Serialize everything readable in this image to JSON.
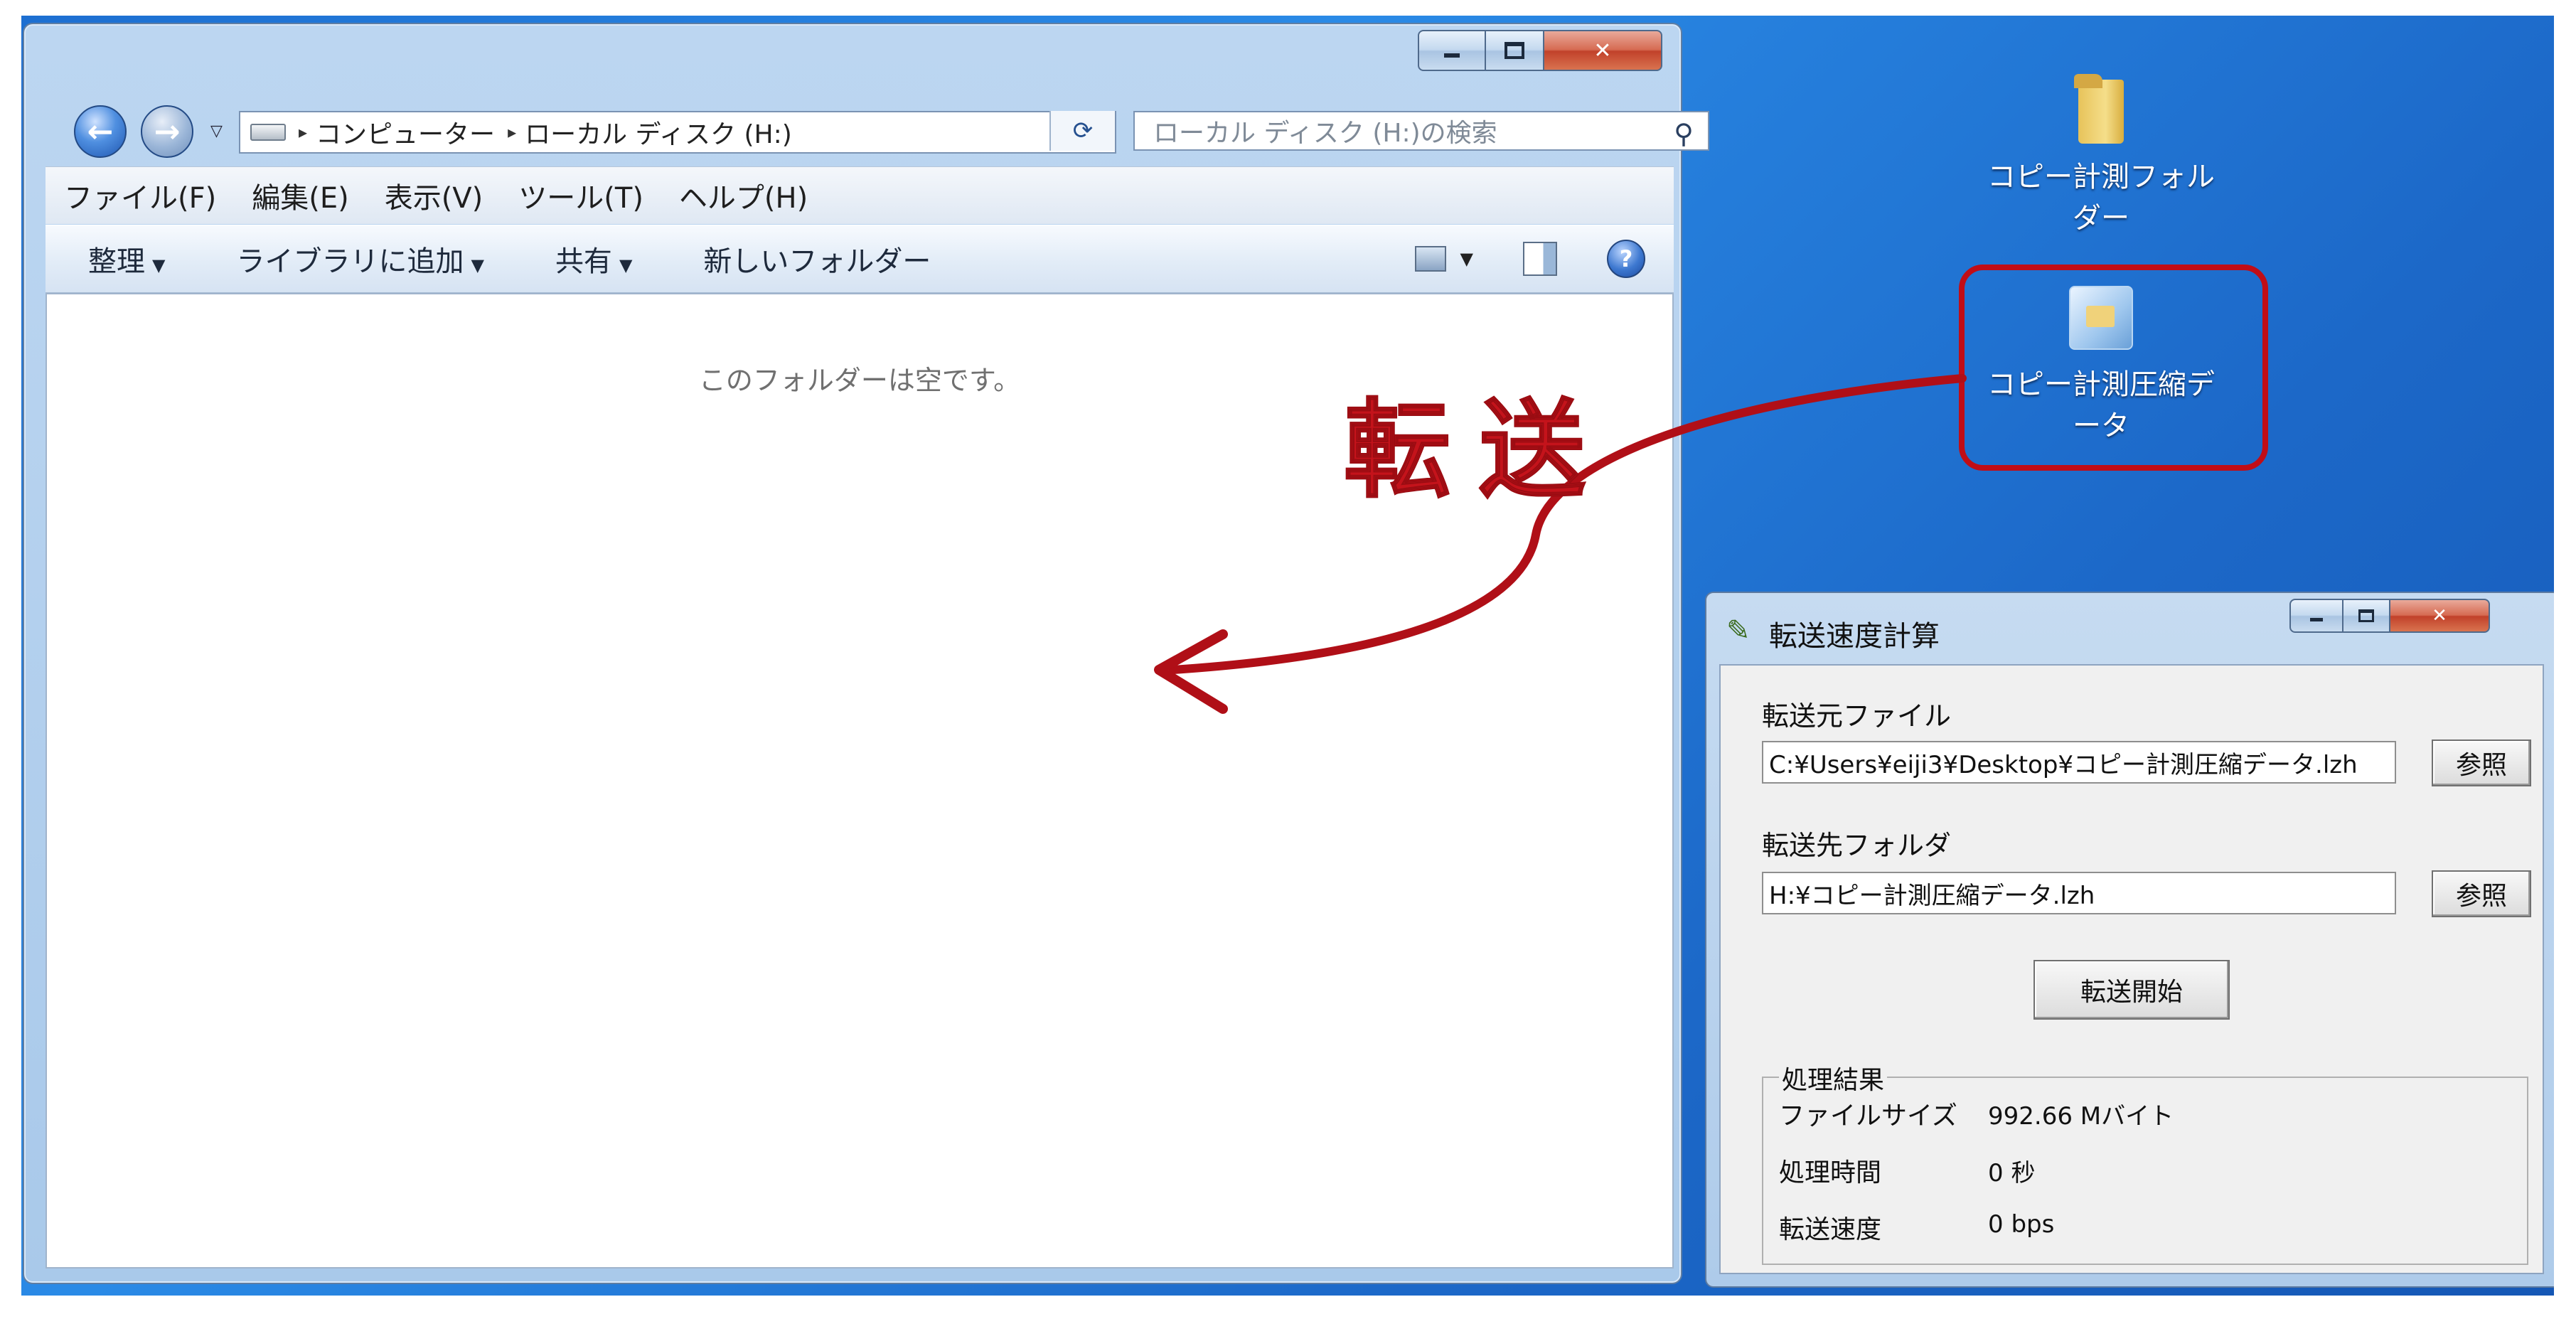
{
  "explorer": {
    "address_segments": [
      "コンピューター",
      "ローカル ディスク (H:)"
    ],
    "search_placeholder": "ローカル ディスク (H:)の検索",
    "menu": [
      "ファイル(F)",
      "編集(E)",
      "表示(V)",
      "ツール(T)",
      "ヘルプ(H)"
    ],
    "commands": [
      "整理",
      "ライブラリに追加",
      "共有",
      "新しいフォルダー"
    ],
    "empty_message": "このフォルダーは空です。"
  },
  "desktop": {
    "icons": [
      {
        "label_line1": "コピー計測フォル",
        "label_line2": "ダー",
        "icon": "folder-icon"
      },
      {
        "label_line1": "コピー計測圧縮デ",
        "label_line2": "ータ",
        "icon": "archive-icon"
      }
    ],
    "annotation_label": "転送",
    "annotation_color": "#c4131b"
  },
  "dialog": {
    "title": "転送速度計算",
    "source_label": "転送元ファイル",
    "source_value": "C:¥Users¥eiji3¥Desktop¥コピー計測圧縮データ.lzh",
    "dest_label": "転送先フォルダ",
    "dest_value": "H:¥コピー計測圧縮データ.lzh",
    "browse_label": "参照",
    "start_label": "転送開始",
    "results_title": "処理結果",
    "results": [
      {
        "key": "ファイルサイズ",
        "value": "992.66 Mバイト"
      },
      {
        "key": "処理時間",
        "value": "0 秒"
      },
      {
        "key": "転送速度",
        "value": "0 bps"
      }
    ]
  }
}
